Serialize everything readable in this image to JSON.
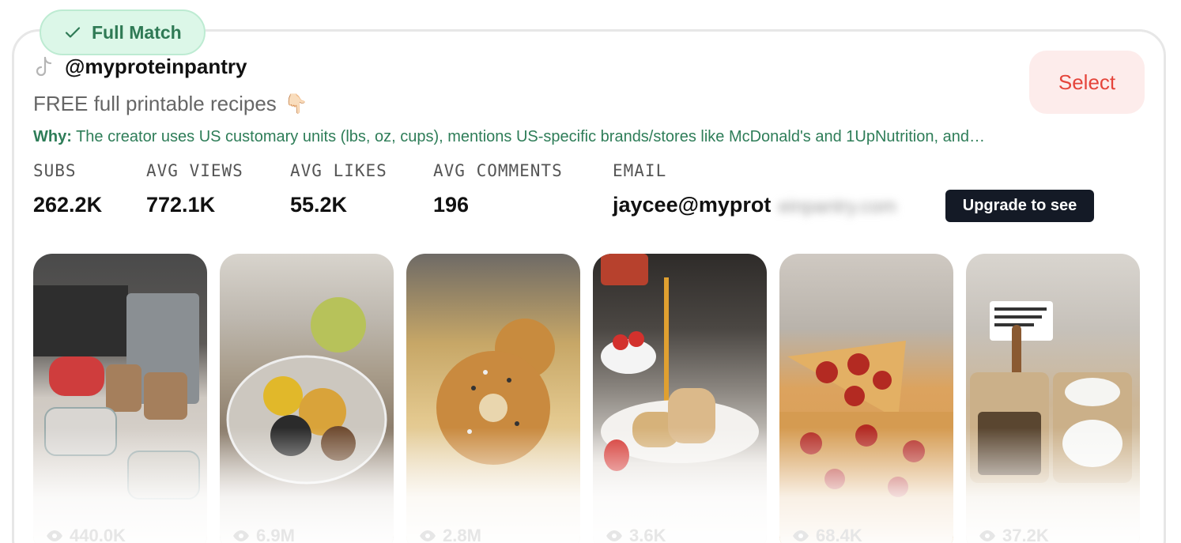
{
  "badge": {
    "label": "Full Match",
    "icon": "check-icon",
    "color": "#2f7a55"
  },
  "creator": {
    "platform_icon": "tiktok-icon",
    "handle": "@myproteinpantry",
    "bio": "FREE full printable recipes",
    "bio_emoji": "👇🏻"
  },
  "select_label": "Select",
  "why": {
    "label": "Why:",
    "text": "The creator uses US customary units (lbs, oz, cups), mentions US-specific brands/stores like McDonald's and 1UpNutrition, and…"
  },
  "stats": [
    {
      "label": "SUBS",
      "value": "262.2K"
    },
    {
      "label": "AVG VIEWS",
      "value": "772.1K"
    },
    {
      "label": "AVG LIKES",
      "value": "55.2K"
    },
    {
      "label": "AVG COMMENTS",
      "value": "196"
    }
  ],
  "email": {
    "label": "EMAIL",
    "visible": "jaycee@myprot",
    "hidden": "einpantry.com",
    "upgrade_label": "Upgrade to see"
  },
  "videos": [
    {
      "views": "440.0K",
      "subject": "meal-prep containers"
    },
    {
      "views": "6.9M",
      "subject": "taco bowl"
    },
    {
      "views": "2.8M",
      "subject": "everything bagel"
    },
    {
      "views": "3.6K",
      "subject": "pancakes with syrup"
    },
    {
      "views": "68.4K",
      "subject": "pepperoni pizza"
    },
    {
      "views": "37.2K",
      "subject": "beef and broccoli rice bowls"
    }
  ],
  "colors": {
    "accent_green": "#2e7d58",
    "select_red": "#e5453b",
    "upgrade_bg": "#141a26"
  }
}
